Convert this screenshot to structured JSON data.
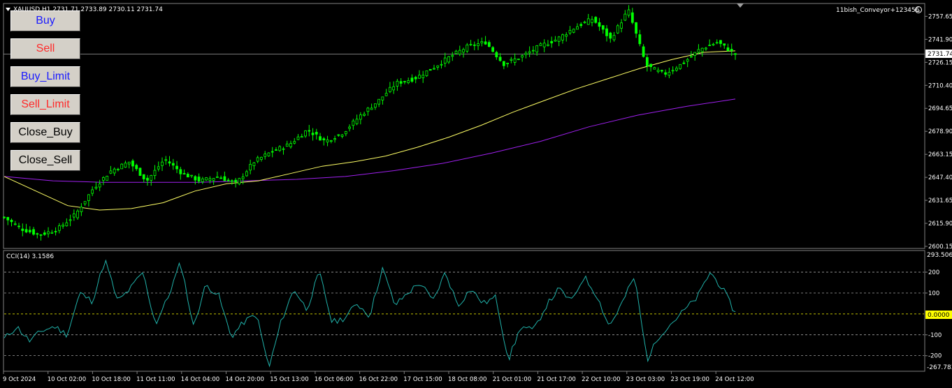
{
  "chart_header": {
    "symbol_line": "XAUUSD,H1  2731.71 2733.89 2730.11 2731.74",
    "expert_label": "11bish_Conveyor+123456"
  },
  "buttons": {
    "buy": "Buy",
    "sell": "Sell",
    "buy_limit": "Buy_Limit",
    "sell_limit": "Sell_Limit",
    "close_buy": "Close_Buy",
    "close_sell": "Close_Sell"
  },
  "price_axis": {
    "ticks": [
      "2757.65",
      "2741.90",
      "2726.15",
      "2710.40",
      "2694.65",
      "2678.90",
      "2663.15",
      "2647.40",
      "2631.65",
      "2615.90",
      "2600.15"
    ],
    "current_price": "2731.74"
  },
  "cci_panel": {
    "label": "CCI(14) 3.1586",
    "top_value": "293.506",
    "bottom_value": "-267.783",
    "current_value": "0.0000",
    "levels": [
      "200",
      "100",
      "-100",
      "-200"
    ]
  },
  "time_axis": {
    "labels": [
      "9 Oct 2024",
      "10 Oct 02:00",
      "10 Oct 18:00",
      "11 Oct 11:00",
      "14 Oct 04:00",
      "14 Oct 20:00",
      "15 Oct 13:00",
      "16 Oct 06:00",
      "16 Oct 22:00",
      "17 Oct 15:00",
      "18 Oct 08:00",
      "21 Oct 01:00",
      "21 Oct 17:00",
      "22 Oct 10:00",
      "23 Oct 03:00",
      "23 Oct 19:00",
      "24 Oct 12:00"
    ]
  },
  "colors": {
    "background": "#000000",
    "candles": "#00ff00",
    "ma_fast": "#ffff66",
    "ma_slow": "#a020f0",
    "cci_line": "#20b2aa",
    "level_lines": "#c0c0c0",
    "zero_line": "#ffff00",
    "price_line": "#a0a0a0"
  },
  "chart_data": {
    "type": "line",
    "x_label_ticks": [
      "9 Oct 2024",
      "10 Oct 02:00",
      "10 Oct 18:00",
      "11 Oct 11:00",
      "14 Oct 04:00",
      "14 Oct 20:00",
      "15 Oct 13:00",
      "16 Oct 06:00",
      "16 Oct 22:00",
      "17 Oct 15:00",
      "18 Oct 08:00",
      "21 Oct 01:00",
      "21 Oct 17:00",
      "22 Oct 10:00",
      "23 Oct 03:00",
      "23 Oct 19:00",
      "24 Oct 12:00"
    ],
    "price_range": [
      2600.15,
      2765.0
    ],
    "price_series_approx": [
      2620,
      2612,
      2608,
      2612,
      2622,
      2640,
      2652,
      2658,
      2645,
      2660,
      2650,
      2645,
      2648,
      2643,
      2658,
      2665,
      2670,
      2680,
      2672,
      2678,
      2690,
      2700,
      2712,
      2715,
      2722,
      2730,
      2737,
      2740,
      2725,
      2730,
      2737,
      2742,
      2750,
      2756,
      2742,
      2762,
      2724,
      2718,
      2725,
      2735,
      2740,
      2731.74
    ],
    "ma_fast_approx": [
      2648,
      2638,
      2628,
      2625,
      2626,
      2630,
      2638,
      2643,
      2645,
      2650,
      2655,
      2658,
      2662,
      2668,
      2675,
      2683,
      2692,
      2700,
      2708,
      2715,
      2722,
      2728,
      2733,
      2734
    ],
    "ma_slow_approx": [
      2648,
      2645,
      2644,
      2644,
      2644,
      2645,
      2646,
      2648,
      2652,
      2657,
      2664,
      2672,
      2682,
      2690,
      2696,
      2701
    ],
    "cci_range": [
      -267.783,
      293.506
    ],
    "cci_series_approx": [
      -120,
      -60,
      -130,
      -80,
      -60,
      -100,
      100,
      60,
      260,
      60,
      120,
      200,
      -50,
      80,
      250,
      -60,
      140,
      90,
      -110,
      -40,
      0,
      -260,
      -30,
      120,
      20,
      200,
      -40,
      -20,
      50,
      -10,
      220,
      40,
      100,
      150,
      60,
      200,
      40,
      120,
      50,
      80,
      -220,
      -60,
      -80,
      40,
      120,
      60,
      180,
      90,
      -60,
      50,
      180,
      -220,
      -100,
      -40,
      20,
      80,
      200,
      120,
      3.16
    ],
    "levels": [
      200,
      100,
      0,
      -100,
      -200
    ]
  }
}
